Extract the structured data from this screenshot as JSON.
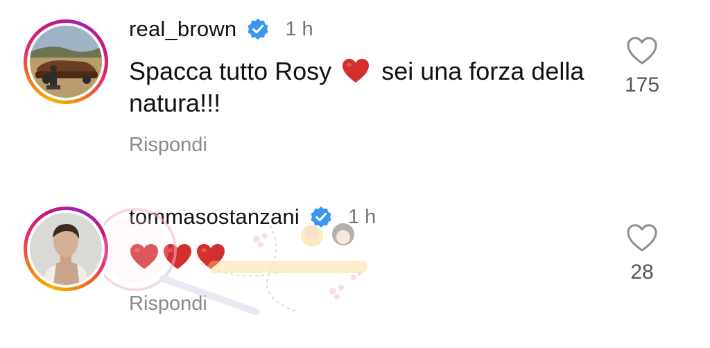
{
  "comments": [
    {
      "username": "real_brown",
      "verified": true,
      "time": "1 h",
      "text_before": "Spacca tutto Rosy",
      "text_after": "sei una forza della natura!!!",
      "reply_label": "Rispondi",
      "like_count": "175",
      "avatar_icon": "avatar-photo-man-with-car",
      "heart_emoji": "red-heart-emoji"
    },
    {
      "username": "tommasostanzani",
      "verified": true,
      "time": "1 h",
      "emoji_count": 3,
      "reply_label": "Rispondi",
      "like_count": "28",
      "avatar_icon": "avatar-photo-young-man",
      "heart_emoji": "red-heart-emoji"
    }
  ],
  "colors": {
    "verified_blue": "#3897F0",
    "heart_red": "#D32F2F",
    "secondary_text": "#757575",
    "ring_gradient": [
      "#F5B400",
      "#F07A1A",
      "#E5266E",
      "#A21FB4"
    ]
  }
}
